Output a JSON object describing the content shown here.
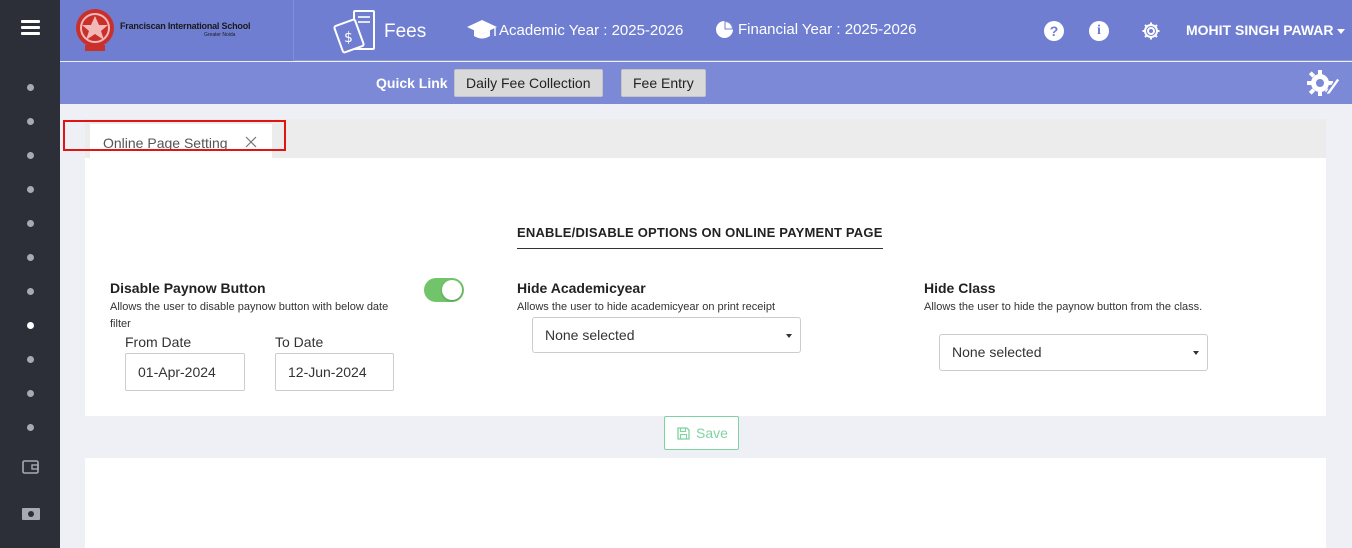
{
  "header": {
    "school_name": "Franciscan International School",
    "school_location": "Greater Noida",
    "module": "Fees",
    "academic_year": "Academic Year : 2025-2026",
    "financial_year": "Financial Year : 2025-2026",
    "help_icon": "?",
    "info_icon": "i",
    "user_name": "MOHIT SINGH PAWAR"
  },
  "quick_links": {
    "label": "Quick Link",
    "buttons": [
      "Daily Fee Collection",
      "Fee Entry"
    ]
  },
  "tab": {
    "label": "Online Page Setting"
  },
  "panel": {
    "title": "ENABLE/DISABLE OPTIONS ON ONLINE PAYMENT PAGE",
    "paynow": {
      "title": "Disable Paynow Button",
      "desc": "Allows the user to disable paynow button with below date filter",
      "enabled": true,
      "from_label": "From Date",
      "from_value": "01-Apr-2024",
      "to_label": "To Date",
      "to_value": "12-Jun-2024"
    },
    "academic": {
      "title": "Hide Academicyear",
      "desc": "Allows the user to hide academicyear on print receipt",
      "selected": "None selected"
    },
    "class": {
      "title": "Hide Class",
      "desc": "Allows the user to hide the paynow button from the class.",
      "selected": "None selected"
    }
  },
  "save_label": "Save",
  "colors": {
    "sidebar": "#2c2f38",
    "header": "#6f7ed1",
    "quickbar": "#7b89d6",
    "toggle_on": "#72c46b",
    "save_accent": "#7fd3a2",
    "highlight": "#e11414"
  },
  "icons": [
    "menu-icon",
    "school-logo",
    "fees-icon",
    "graduation-cap-icon",
    "pie-chart-icon",
    "help-icon",
    "info-icon",
    "gear-icon",
    "settings-edit-icon",
    "close-icon",
    "save-icon",
    "wallet-icon",
    "cash-icon"
  ]
}
